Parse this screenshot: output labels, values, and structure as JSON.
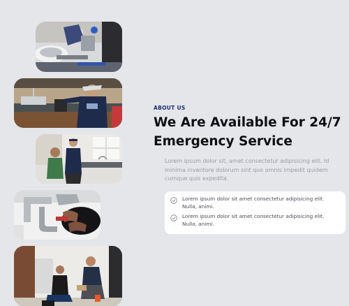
{
  "section": {
    "eyebrow": "ABOUT US",
    "title": "We Are Available For 24/7 Emergency Service",
    "description": "Lorem ipsum dolor sit, amet consectetur adipisicing elit. Id minima inventore dolorum sint quo omnis impedit quidem cumque quis expedita."
  },
  "features": [
    "Lorem ipsum dolor sit amet consectetur adipisicing elit. Nulla, animi.",
    "Lorem ipsum dolor sit amet consectetur adipisicing elit. Nulla, animi."
  ],
  "icons": {
    "feature": "check-circle-icon"
  },
  "colors": {
    "background": "#e4e6ea",
    "accent": "#1f2f77",
    "title": "#0f0f10",
    "muted_text": "#9a9ca3"
  }
}
